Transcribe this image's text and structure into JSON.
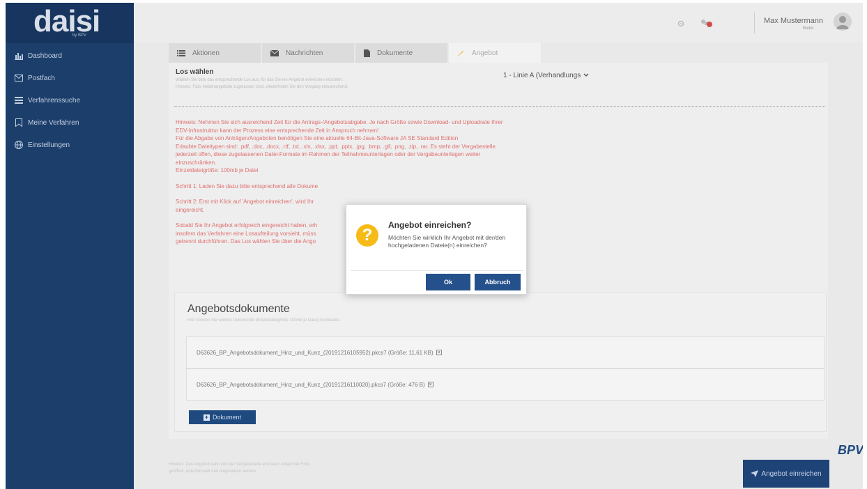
{
  "sidebar": {
    "logo": "daisi",
    "logo_sub": "by BPV",
    "items": [
      {
        "label": "Dashboard",
        "icon": "bar-chart-icon"
      },
      {
        "label": "Postfach",
        "icon": "envelope-icon"
      },
      {
        "label": "Verfahrenssuche",
        "icon": "list-icon"
      },
      {
        "label": "Meine Verfahren",
        "icon": "bookmark-icon"
      },
      {
        "label": "Einstellungen",
        "icon": "globe-icon"
      }
    ]
  },
  "topbar": {
    "user_name": "Max Mustermann",
    "user_role": "Bieter"
  },
  "tabs": [
    {
      "label": "Aktionen",
      "icon": "list-icon"
    },
    {
      "label": "Nachrichten",
      "icon": "envelope-icon"
    },
    {
      "label": "Dokumente",
      "icon": "document-icon"
    },
    {
      "label": "Angebot",
      "icon": "pencil-icon"
    }
  ],
  "los": {
    "title": "Los wählen",
    "help1": "Wählen Sie bitte das entsprechende Los aus, für das Sie ein Angebot einreichen möchten.",
    "help2": "Hinweis: Falls Nebenangebote zugelassen sind, wiederholen Sie den Vorgang entsprechend.",
    "selected": "1 - Linie A (Verhandlungs"
  },
  "warning": {
    "p1": "Hinweis: Nehmen Sie sich ausreichend Zeit für die Antrags-/Angebotsabgabe. Je nach Größe sowie Download- und Uploadrate Ihrer EDV-Infrastruktur kann der Prozess eine entsprechende Zeit in Anspruch nehmen!",
    "p2": "Für die Abgabe von Anträgen/Angeboten benötigen Sie eine aktuelle 64-Bit-Java-Software JA SE Standard Edition",
    "p3": "Erlaubte Dateitypen sind: .pdf, .doc, .docx, .rtf, .txt, .xls, .xlsx, .ppt, .pptx, .jpg, .bmp, .gif, .png, .zip, .rar. Es steht der Vergabestelle jederzeit offen, diese zugelassenen Datei-Formate im Rahmen der Teilnahmeunterlagen oder der Vergabeunterlagen weiter einzuschränken.",
    "p4": "Einzeldateigröße: 100mb je Datei",
    "p5": "Schritt 1: Laden Sie dazu bitte entsprechend alle Dokume",
    "p6": "Schritt 2: Erst mit Klick auf 'Angebot einreichen', wird Ihr",
    "p6b": "eingereicht.",
    "p7": "Sobald Sie Ihr Angebot erfolgreich eingereicht haben, erh",
    "p7b": "insofern das Verfahren eine Losaufteilung vorsieht, müss",
    "p7c": "getrennt durchführen. Das Los wählen Sie über die Ango"
  },
  "docs": {
    "title": "Angebotsdokumente",
    "help": "Hier können Sie weitere Dokumente (Einzeldateigröße 100mb je Datei) hochladen.",
    "files": [
      "D63626_BP_Angebotsdokument_Hinz_und_Kunz_(20191216105952).pkcs7 (Größe: 11,61 KB)",
      "D63626_BP_Angebotsdokument_Hinz_und_Kunz_(20191216110020).pkcs7 (Größe: 476 B)"
    ],
    "add_label": "Dokument"
  },
  "footer": {
    "note1": "Hinweis: Das Angebot kann von der Vergabestelle erst nach Ablauf der Frist",
    "note2": "geöffnet, entschlüsselt und eingesehen werden.",
    "submit_label": "Angebot einreichen",
    "brand": "BPV"
  },
  "dialog": {
    "title": "Angebot einreichen?",
    "message": "Möchten Sie wirklich Ihr Angebot mit der/den hochgeladenen Dateie(n) einreichen?",
    "ok_label": "Ok",
    "cancel_label": "Abbruch",
    "icon_glyph": "?"
  },
  "colors": {
    "sidebar_bg": "#1c3e6b",
    "primary_button": "#24508b",
    "warning_text": "#e07070",
    "dialog_icon": "#f6bb17"
  }
}
